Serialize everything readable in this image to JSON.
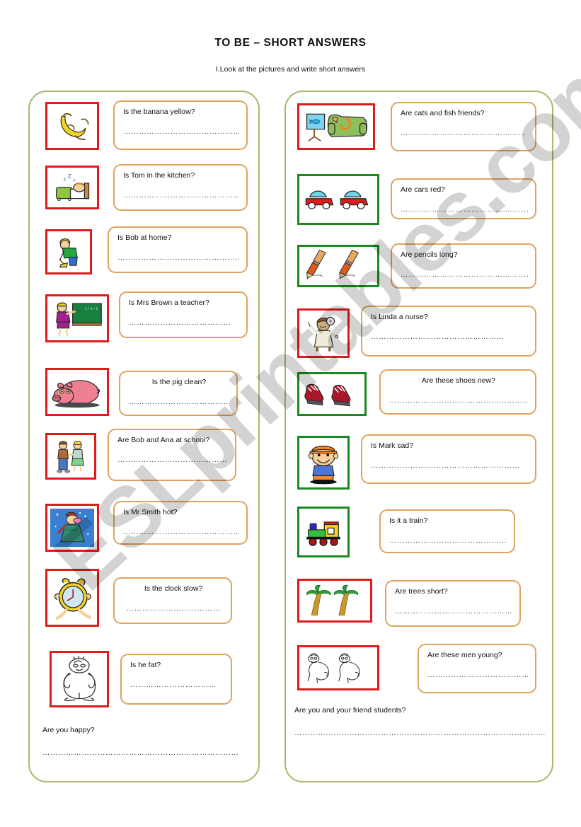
{
  "header": {
    "title": "TO  BE – SHORT ANSWERS",
    "instruction": "I.Look at the pictures and write short answers"
  },
  "watermark": {
    "text": "ESLprintables.com"
  },
  "colors": {
    "frame_red": "#e01b1b",
    "frame_green": "#1a8a1e",
    "answer_border": "#e0a35e",
    "column_border": "#a3bb6e",
    "watermark": "#cccccc"
  },
  "dots": {
    "long": "……………………………………………",
    "medium": "…………………………………",
    "short": "………………………………",
    "xlong": "………………………………………………………………"
  },
  "left_column": {
    "items": [
      {
        "picture": "banana-icon",
        "frame": "red",
        "question": "Is the banana yellow?",
        "answer_line": "………………………………………"
      },
      {
        "picture": "sleeping-man-icon",
        "frame": "red",
        "question": "Is Tom in the kitchen?",
        "answer_line": "………………………………………"
      },
      {
        "picture": "cleaning-boy-icon",
        "frame": "red",
        "question": "Is Bob at home?",
        "answer_line": "…………………………………………"
      },
      {
        "picture": "teacher-icon",
        "frame": "red",
        "question": "Is Mrs Brown a teacher?",
        "answer_line": "…………………………………"
      },
      {
        "picture": "pig-icon",
        "frame": "red",
        "question": "Is the pig clean?",
        "answer_line": "…………………………………"
      },
      {
        "picture": "two-students-icon",
        "frame": "red",
        "question": "Are Bob and Ana at school?",
        "answer_line": "………………………………………"
      },
      {
        "picture": "cold-person-icon",
        "frame": "red",
        "question": "Is Mr Smith hot?",
        "answer_line": "………………………………………"
      },
      {
        "picture": "running-clock-icon",
        "frame": "red",
        "question": "Is the clock slow?",
        "answer_line": "………………………………"
      },
      {
        "picture": "fat-man-icon",
        "frame": "red",
        "question": "Is he fat?",
        "answer_line": "……………………………"
      }
    ],
    "footer_question": "Are you happy?",
    "footer_answer_line": "…………………………………………………………………"
  },
  "right_column": {
    "items": [
      {
        "picture": "cat-and-fish-icon",
        "frame": "red",
        "question": "Are cats and  fish friends?",
        "answer_line": "…………………………………………"
      },
      {
        "picture": "two-red-cars-icon",
        "frame": "green",
        "question": "Are cars red?",
        "answer_line": "…………………………………………………"
      },
      {
        "picture": "two-pencils-icon",
        "frame": "green",
        "question": "Are pencils long?",
        "answer_line": "………………………………………………"
      },
      {
        "picture": "nurse-icon",
        "frame": "red",
        "question": "Is Linda a nurse?",
        "answer_line": "……………………………………………"
      },
      {
        "picture": "red-shoes-icon",
        "frame": "green",
        "question": "Are these shoes new?",
        "answer_line": "………………………………………………"
      },
      {
        "picture": "happy-boy-icon",
        "frame": "green",
        "question": "Is Mark sad?",
        "answer_line": "…………………………………………………"
      },
      {
        "picture": "toy-train-icon",
        "frame": "green",
        "question": "Is it a train?",
        "answer_line": "………………………………………………"
      },
      {
        "picture": "palm-trees-icon",
        "frame": "red",
        "question": "Are trees short?",
        "answer_line": "………………………………………"
      },
      {
        "picture": "two-old-men-icon",
        "frame": "red",
        "question": "Are these men young?",
        "answer_line": "………………………………………"
      }
    ],
    "footer_question": "Are you and your friend students?",
    "footer_answer_line": "……………………………………………………………………………………"
  }
}
